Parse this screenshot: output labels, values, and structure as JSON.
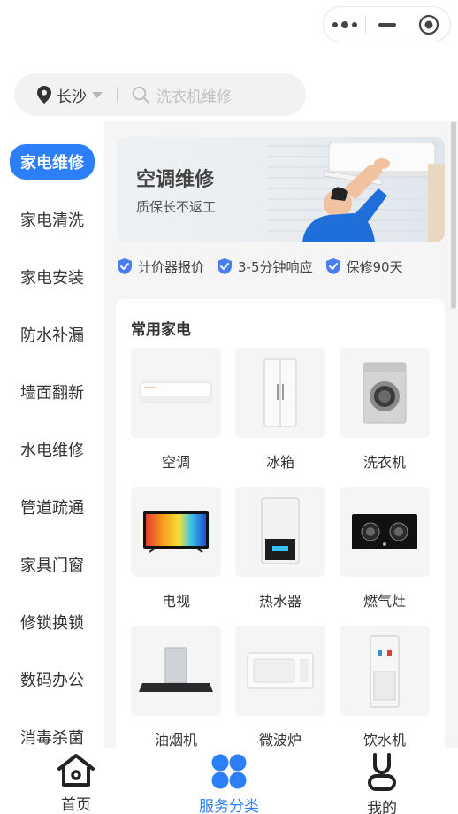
{
  "capsule": {
    "more_icon": "more-dots-icon",
    "minimize_icon": "minimize-icon",
    "close_icon": "target-icon"
  },
  "search": {
    "city": "长沙",
    "placeholder": "洗衣机维修",
    "location_icon": "location-pin-icon",
    "search_icon": "search-icon"
  },
  "sidebar": {
    "items": [
      {
        "label": "家电维修",
        "active": true
      },
      {
        "label": "家电清洗"
      },
      {
        "label": "家电安装"
      },
      {
        "label": "防水补漏"
      },
      {
        "label": "墙面翻新"
      },
      {
        "label": "水电维修"
      },
      {
        "label": "管道疏通"
      },
      {
        "label": "家具门窗"
      },
      {
        "label": "修锁换锁"
      },
      {
        "label": "数码办公"
      },
      {
        "label": "消毒杀菌"
      }
    ]
  },
  "banner": {
    "title": "空调维修",
    "subtitle": "质保长不返工"
  },
  "guarantees": [
    {
      "label": "计价器报价",
      "icon": "shield-check-icon"
    },
    {
      "label": "3-5分钟响应",
      "icon": "shield-check-icon"
    },
    {
      "label": "保修90天",
      "icon": "shield-check-icon"
    }
  ],
  "common": {
    "title": "常用家电",
    "items": [
      {
        "label": "空调"
      },
      {
        "label": "冰箱"
      },
      {
        "label": "洗衣机"
      },
      {
        "label": "电视"
      },
      {
        "label": "热水器"
      },
      {
        "label": "燃气灶"
      },
      {
        "label": "油烟机"
      },
      {
        "label": "微波炉"
      },
      {
        "label": "饮水机"
      }
    ]
  },
  "tabbar": {
    "items": [
      {
        "label": "首页",
        "icon": "home-icon"
      },
      {
        "label": "服务分类",
        "icon": "category-icon",
        "active": true
      },
      {
        "label": "我的",
        "icon": "profile-icon"
      }
    ]
  },
  "colors": {
    "accent": "#2d7ff9",
    "shield": "#4a7df0"
  }
}
